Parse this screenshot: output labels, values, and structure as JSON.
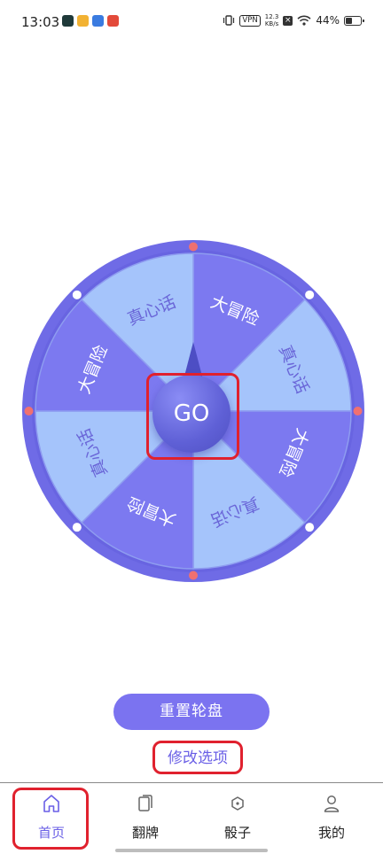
{
  "status_bar": {
    "time": "13:03",
    "vpn": "VPN",
    "net_speed_value": "12.3",
    "net_speed_unit": "KB/s",
    "battery": "44%",
    "battery_level": 0.44
  },
  "wheel": {
    "center_button": "GO",
    "segments": [
      {
        "label": "大冒险",
        "color": "#7c79f0"
      },
      {
        "label": "真心话",
        "color": "#a5c4fb"
      },
      {
        "label": "大冒险",
        "color": "#7c79f0"
      },
      {
        "label": "真心话",
        "color": "#a5c4fb"
      },
      {
        "label": "大冒险",
        "color": "#7c79f0"
      },
      {
        "label": "真心话",
        "color": "#a5c4fb"
      },
      {
        "label": "大冒险",
        "color": "#7c79f0"
      },
      {
        "label": "真心话",
        "color": "#a5c4fb"
      }
    ],
    "rim_color": "#6f6be6",
    "dot_colors": [
      "#f07070",
      "#ffffff"
    ]
  },
  "actions": {
    "reset_label": "重置轮盘",
    "modify_label": "修改选项"
  },
  "bottom_nav": {
    "items": [
      {
        "label": "首页",
        "icon": "home-icon",
        "active": true
      },
      {
        "label": "翻牌",
        "icon": "cards-icon",
        "active": false
      },
      {
        "label": "骰子",
        "icon": "dice-icon",
        "active": false
      },
      {
        "label": "我的",
        "icon": "person-icon",
        "active": false
      }
    ],
    "accent": "#6a5fe6"
  }
}
